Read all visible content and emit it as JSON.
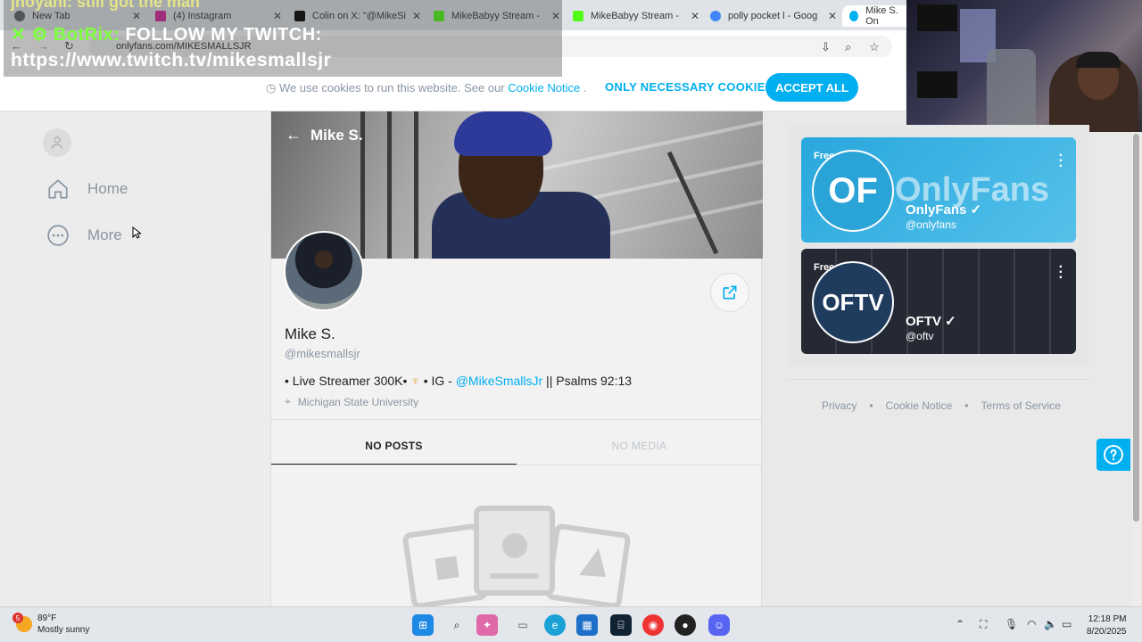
{
  "browser": {
    "tabs": [
      {
        "title": "New Tab",
        "icon": "chrome-icon"
      },
      {
        "title": "(4) Instagram",
        "icon": "instagram-icon"
      },
      {
        "title": "Colin on X: \"@MikeSi",
        "icon": "x-icon"
      },
      {
        "title": "MikeBabyy Stream - ",
        "icon": "kick-icon"
      },
      {
        "title": "MikeBabyy Stream - ",
        "icon": "kick-icon"
      },
      {
        "title": "polly pocket l - Goog",
        "icon": "google-icon"
      },
      {
        "title": "Mike S. On",
        "icon": "onlyfans-icon"
      }
    ],
    "url": "onlyfans.com/MIKESMALLSJR"
  },
  "overlay": {
    "top_text": "jhoyani: still got the man",
    "bot_name": "BotRix:",
    "line1": "FOLLOW MY TWITCH:",
    "line2": "https://www.twitch.tv/mikesmallsjr"
  },
  "cookie": {
    "text": "We use cookies to run this website. See our",
    "link": "Cookie Notice",
    "period": ".",
    "only_necessary": "ONLY NECESSARY COOKIES",
    "accept_all": "ACCEPT ALL"
  },
  "sidebar": {
    "items": [
      {
        "label": "Home",
        "icon": "home-icon"
      },
      {
        "label": "More",
        "icon": "more-icon"
      }
    ]
  },
  "profile": {
    "header_name": "Mike S.",
    "name": "Mike S.",
    "handle": "@mikesmallsjr",
    "bio_prefix": "• Live Streamer 300K• ",
    "bio_trident": "♆",
    "bio_mid": " • IG - ",
    "bio_link": "@MikeSmallsJr",
    "bio_suffix": " || Psalms 92:13",
    "location": "Michigan State University",
    "tabs": [
      "NO POSTS",
      "NO MEDIA"
    ]
  },
  "suggestions": [
    {
      "badge": "Free",
      "name": "OnlyFans",
      "handle": "@onlyfans",
      "banner_text": "OnlyFans",
      "avatar_text": "OF"
    },
    {
      "badge": "Free",
      "name": "OFTV",
      "handle": "@oftv",
      "banner_text": "",
      "avatar_text": "OFTV"
    }
  ],
  "footer": {
    "links": [
      "Privacy",
      "Cookie Notice",
      "Terms of Service"
    ],
    "sep": "•"
  },
  "taskbar": {
    "weather_temp": "89°F",
    "weather_desc": "Mostly sunny",
    "weather_badge": "5",
    "time": "12:18 PM",
    "date": "8/20/2025"
  },
  "colors": {
    "accent": "#00aff0",
    "muted": "#8a96a3"
  }
}
